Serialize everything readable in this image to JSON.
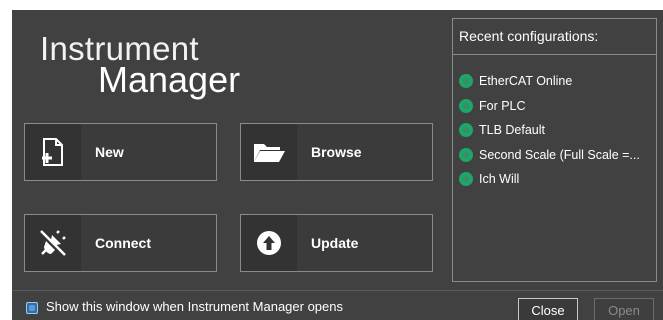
{
  "title": {
    "line1": "Instrument",
    "line2": "Manager"
  },
  "actions": {
    "new": {
      "label": "New",
      "icon": "new-file-icon"
    },
    "browse": {
      "label": "Browse",
      "icon": "folder-icon"
    },
    "connect": {
      "label": "Connect",
      "icon": "plug-icon"
    },
    "update": {
      "label": "Update",
      "icon": "upload-arrow-icon"
    }
  },
  "recent": {
    "title": "Recent configurations:",
    "items": [
      {
        "label": "EtherCAT Online"
      },
      {
        "label": "For PLC"
      },
      {
        "label": "TLB Default"
      },
      {
        "label": "Second Scale (Full Scale =..."
      },
      {
        "label": "Ich Will"
      }
    ]
  },
  "footer": {
    "show_window_label": "Show this window when Instrument Manager opens",
    "show_window_checked": true,
    "close_label": "Close",
    "open_label": "Open"
  },
  "colors": {
    "background": "#414141",
    "status_dot": "#1ea56a",
    "checkbox": "#2f6fb0"
  }
}
